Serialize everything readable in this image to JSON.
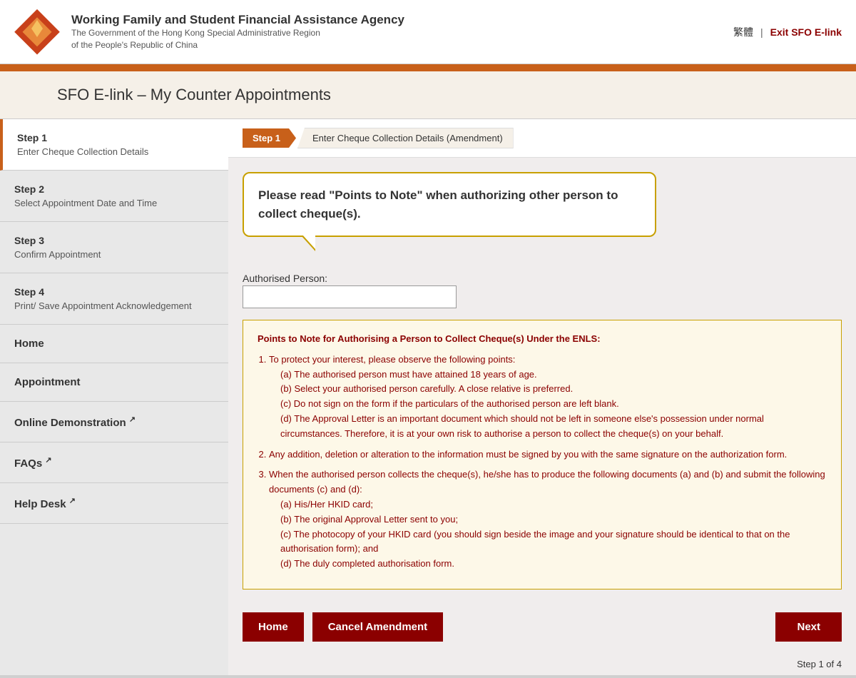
{
  "header": {
    "agency_name": "Working Family and Student Financial Assistance Agency",
    "agency_sub1": "The Government of the Hong Kong Special Administrative Region",
    "agency_sub2": "of the People's Republic of China",
    "lang_label": "繁體",
    "divider": "|",
    "exit_label": "Exit SFO E-link"
  },
  "page_title": "SFO E-link – My Counter Appointments",
  "breadcrumb": {
    "step_label": "Step 1",
    "page_label": "Enter Cheque Collection Details (Amendment)"
  },
  "steps": [
    {
      "label": "Step 1",
      "desc": "Enter Cheque Collection Details"
    },
    {
      "label": "Step 2",
      "desc": "Select Appointment Date and Time"
    },
    {
      "label": "Step 3",
      "desc": "Confirm Appointment"
    },
    {
      "label": "Step 4",
      "desc": "Print/ Save Appointment Acknowledgement"
    }
  ],
  "nav_items": [
    {
      "label": "Home",
      "ext": false
    },
    {
      "label": "Appointment",
      "ext": false
    },
    {
      "label": "Online Demonstration",
      "ext": true
    },
    {
      "label": "FAQs",
      "ext": true
    },
    {
      "label": "Help Desk",
      "ext": true
    }
  ],
  "tooltip": {
    "text": "Please read \"Points to Note\" when authorizing other person to collect cheque(s)."
  },
  "form": {
    "auth_label": "Authorised Person:",
    "auth_placeholder": ""
  },
  "points_box": {
    "title": "Points to Note for Authorising a Person to Collect Cheque(s) Under the ENLS:",
    "item1": "To protect your interest, please observe the following points:",
    "item1a": "(a) The authorised person must have attained 18 years of age.",
    "item1b": "(b) Select your authorised person carefully. A close relative is preferred.",
    "item1c": "(c) Do not sign on the form if the particulars of the authorised person are left blank.",
    "item1d": "(d) The Approval Letter is an important document which should not be left in someone else's possession under normal circumstances. Therefore, it is at your own risk to authorise a person to collect the cheque(s) on your behalf.",
    "item2": "Any addition, deletion or alteration to the information must be signed by you with the same signature on the authorization form.",
    "item3": "When the authorised person collects the cheque(s), he/she has to produce the following documents (a) and (b) and submit the following documents (c) and (d):",
    "item3a": "(a) His/Her HKID card;",
    "item3b": "(b) The original Approval Letter sent to you;",
    "item3c": "(c) The photocopy of your HKID card (you should sign beside the image and your signature should be identical to that on the authorisation form); and",
    "item3d": "(d) The duly completed authorisation form."
  },
  "buttons": {
    "home": "Home",
    "cancel": "Cancel Amendment",
    "next": "Next"
  },
  "step_count": "Step 1 of 4"
}
